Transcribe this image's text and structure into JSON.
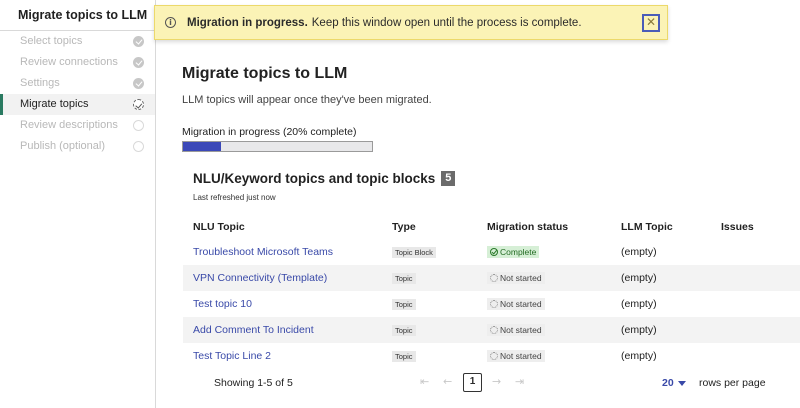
{
  "sidebar": {
    "title": "Migrate topics to LLM",
    "steps": [
      {
        "label": "Select topics",
        "state": "done"
      },
      {
        "label": "Review connections",
        "state": "done"
      },
      {
        "label": "Settings",
        "state": "done"
      },
      {
        "label": "Migrate topics",
        "state": "active"
      },
      {
        "label": "Review descriptions",
        "state": "pending"
      },
      {
        "label": "Publish (optional)",
        "state": "pending"
      }
    ]
  },
  "banner": {
    "icon": "info-icon",
    "strong": "Migration in progress.",
    "text": "Keep this window open until the process is complete.",
    "close_glyph": "✕"
  },
  "main": {
    "title": "Migrate topics to LLM",
    "description": "LLM topics will appear once they've been migrated.",
    "progress": {
      "label": "Migration in progress (20% complete)",
      "percent": 20
    },
    "section": {
      "title": "NLU/Keyword topics and topic blocks",
      "count": "5",
      "refreshed": "Last refreshed just now"
    },
    "table": {
      "headers": [
        "NLU Topic",
        "Type",
        "Migration status",
        "LLM Topic",
        "Issues"
      ],
      "rows": [
        {
          "topic": "Troubleshoot Microsoft Teams",
          "type": "Topic Block",
          "status": "Complete",
          "llm": "(empty)",
          "issues": ""
        },
        {
          "topic": "VPN Connectivity (Template)",
          "type": "Topic",
          "status": "Not started",
          "llm": "(empty)",
          "issues": ""
        },
        {
          "topic": "Test topic 10",
          "type": "Topic",
          "status": "Not started",
          "llm": "(empty)",
          "issues": ""
        },
        {
          "topic": "Add Comment To Incident",
          "type": "Topic",
          "status": "Not started",
          "llm": "(empty)",
          "issues": ""
        },
        {
          "topic": "Test Topic Line 2",
          "type": "Topic",
          "status": "Not started",
          "llm": "(empty)",
          "issues": ""
        }
      ]
    },
    "pager": {
      "showing": "Showing 1-5 of 5",
      "first": "⇤",
      "prev": "←",
      "current": "1",
      "next": "→",
      "last": "⇥",
      "rows_value": "20",
      "rows_label": "rows per page"
    }
  },
  "colors": {
    "accent": "#3949a8",
    "banner_bg": "#fbf3b6",
    "active_marker": "#2a7a61",
    "progress_fill": "#3b48b8"
  }
}
